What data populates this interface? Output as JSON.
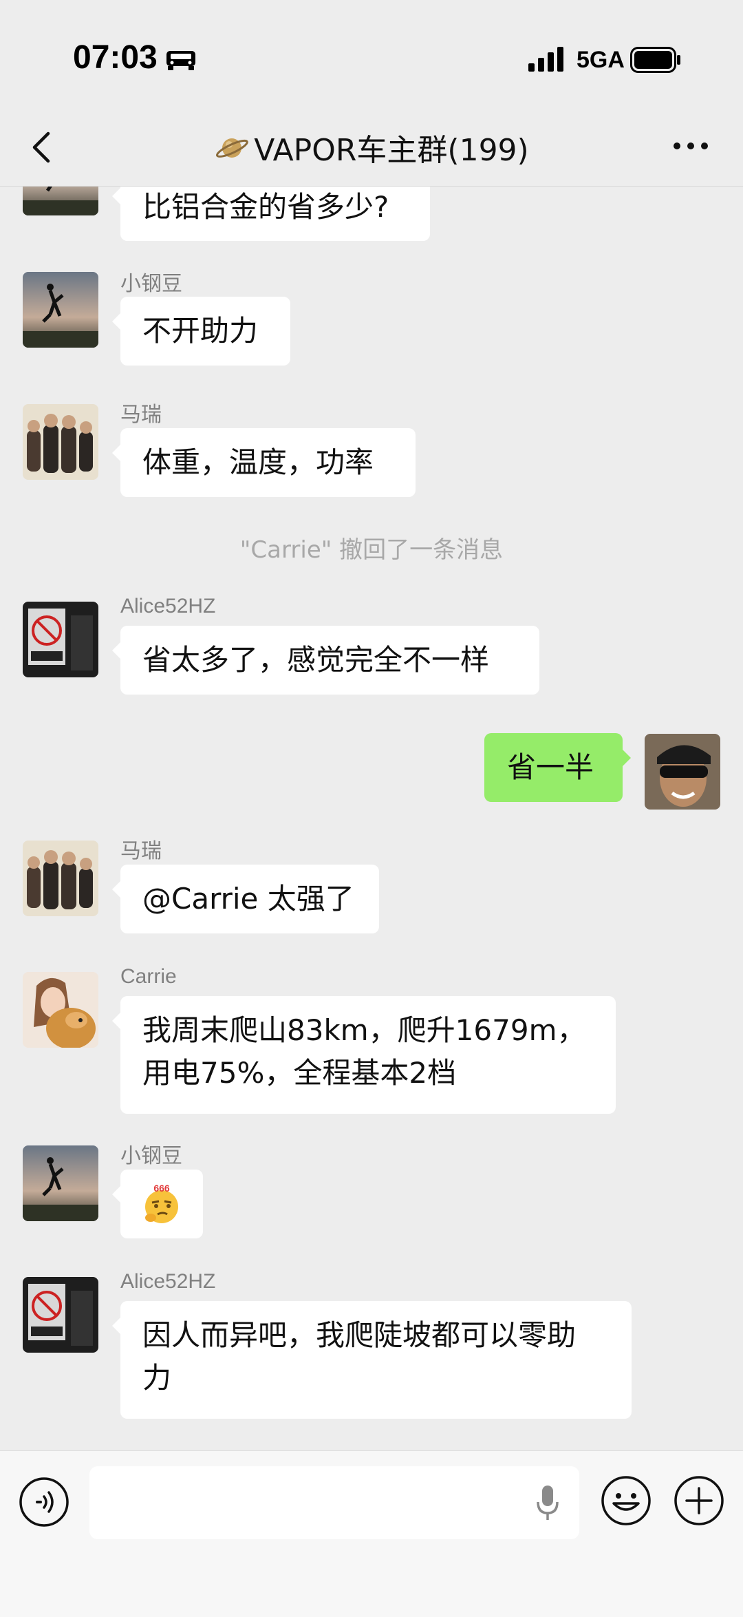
{
  "status_bar": {
    "time": "07:03",
    "network": "5GA"
  },
  "header": {
    "title": "VAPOR车主群(199)"
  },
  "messages": [
    {
      "type": "incoming",
      "sender": "",
      "text": "比铝合金的省多少?"
    },
    {
      "type": "incoming",
      "sender": "小钢豆",
      "text": "不开助力"
    },
    {
      "type": "incoming",
      "sender": "马瑞",
      "text": "体重，温度，功率"
    },
    {
      "type": "system",
      "text": "\"Carrie\" 撤回了一条消息"
    },
    {
      "type": "incoming",
      "sender": "Alice52HZ",
      "text": "省太多了，感觉完全不一样"
    },
    {
      "type": "outgoing",
      "text": "省一半"
    },
    {
      "type": "incoming",
      "sender": "马瑞",
      "text": "@Carrie 太强了"
    },
    {
      "type": "incoming",
      "sender": "Carrie",
      "text_line1": "我周末爬山83km，爬升1679m，",
      "text_line2": "用电75%，全程基本2档"
    },
    {
      "type": "incoming",
      "sender": "小钢豆",
      "sticker": "666",
      "icon": "thinking-666-emoji"
    },
    {
      "type": "incoming",
      "sender": "Alice52HZ",
      "text_line1": "因人而异吧，我爬陡坡都可以零助",
      "text_line2": "力"
    }
  ],
  "input_bar": {
    "placeholder": ""
  },
  "colors": {
    "background": "#ededed",
    "outgoing_bubble": "#95ec69",
    "incoming_bubble": "#ffffff",
    "notice_text": "#a8a8a8"
  }
}
